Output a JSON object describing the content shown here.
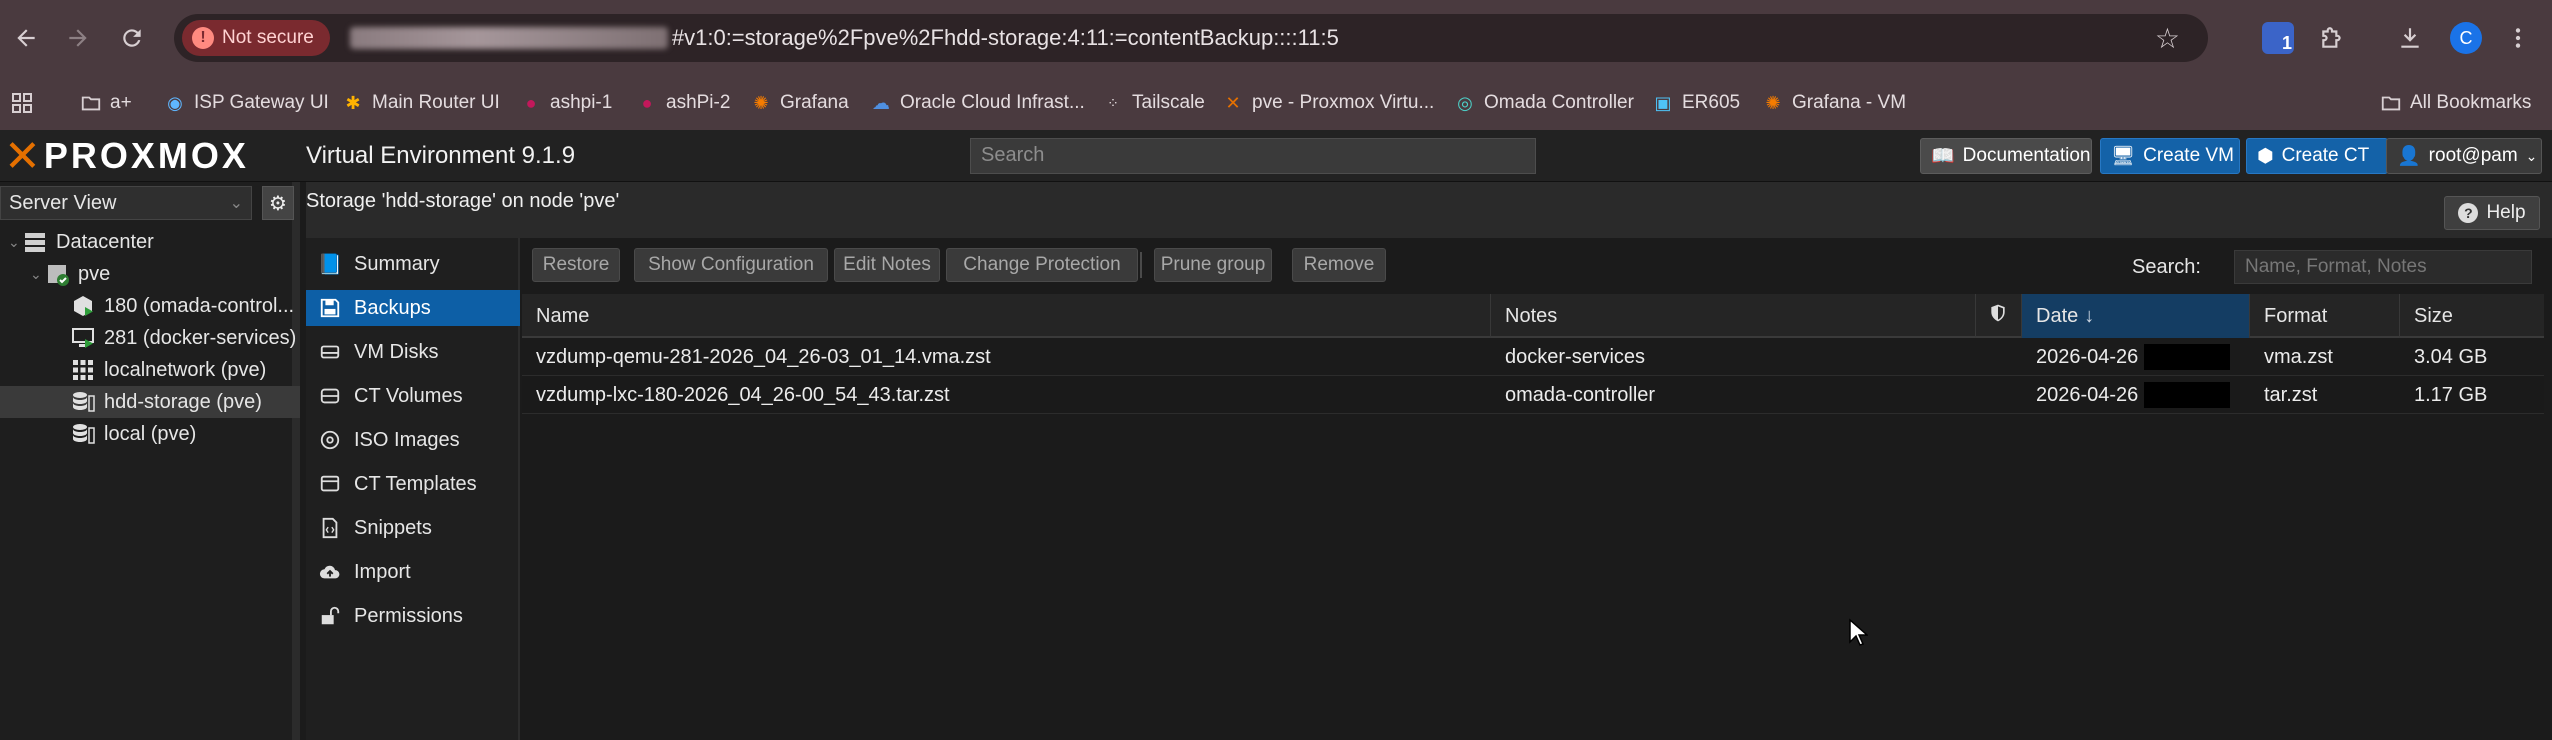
{
  "browser": {
    "not_secure_label": "Not secure",
    "url_visible": "#v1:0:=storage%2Fpve%2Fhdd-storage:4:11:=contentBackup::::11:5",
    "extension_badge": "1",
    "profile_initial": "C",
    "bookmarks": [
      {
        "label": "a+",
        "icon": "folder-icon"
      },
      {
        "label": "ISP Gateway UI",
        "icon": "globe-icon"
      },
      {
        "label": "Main Router UI",
        "icon": "router-icon"
      },
      {
        "label": "ashpi-1",
        "icon": "raspberry-icon"
      },
      {
        "label": "ashPi-2",
        "icon": "raspberry-icon"
      },
      {
        "label": "Grafana",
        "icon": "grafana-icon"
      },
      {
        "label": "Oracle Cloud Infrast...",
        "icon": "cloud-icon"
      },
      {
        "label": "Tailscale",
        "icon": "tailscale-icon"
      },
      {
        "label": "pve - Proxmox Virtu...",
        "icon": "proxmox-icon"
      },
      {
        "label": "Omada Controller",
        "icon": "omada-icon"
      },
      {
        "label": "ER605",
        "icon": "tplink-icon"
      },
      {
        "label": "Grafana - VM",
        "icon": "grafana-icon"
      }
    ],
    "all_bookmarks_label": "All Bookmarks"
  },
  "header": {
    "logo_text": "PROXMOX",
    "version": "Virtual Environment 9.1.9",
    "search_placeholder": "Search",
    "documentation_label": "Documentation",
    "create_vm_label": "Create VM",
    "create_ct_label": "Create CT",
    "user_label": "root@pam"
  },
  "tree": {
    "view_label": "Server View",
    "items": [
      {
        "label": "Datacenter",
        "icon": "datacenter-icon"
      },
      {
        "label": "pve",
        "icon": "node-icon"
      },
      {
        "label": "180 (omada-control...",
        "icon": "container-icon"
      },
      {
        "label": "281 (docker-services)",
        "icon": "vm-icon"
      },
      {
        "label": "localnetwork (pve)",
        "icon": "network-icon"
      },
      {
        "label": "hdd-storage (pve)",
        "icon": "storage-icon"
      },
      {
        "label": "local (pve)",
        "icon": "storage-icon"
      }
    ]
  },
  "content": {
    "title": "Storage 'hdd-storage' on node 'pve'",
    "help_label": "Help",
    "nav": [
      {
        "label": "Summary",
        "icon": "book-icon"
      },
      {
        "label": "Backups",
        "icon": "floppy-icon"
      },
      {
        "label": "VM Disks",
        "icon": "disk-icon"
      },
      {
        "label": "CT Volumes",
        "icon": "volume-icon"
      },
      {
        "label": "ISO Images",
        "icon": "disc-icon"
      },
      {
        "label": "CT Templates",
        "icon": "template-icon"
      },
      {
        "label": "Snippets",
        "icon": "file-code-icon"
      },
      {
        "label": "Import",
        "icon": "cloud-upload-icon"
      },
      {
        "label": "Permissions",
        "icon": "unlock-icon"
      }
    ],
    "toolbar": {
      "restore": "Restore",
      "show_configuration": "Show Configuration",
      "edit_notes": "Edit Notes",
      "change_protection": "Change Protection",
      "prune_group": "Prune group",
      "remove": "Remove",
      "search_label": "Search:",
      "search_placeholder": "Name, Format, Notes"
    },
    "columns": {
      "name": "Name",
      "notes": "Notes",
      "date": "Date",
      "format": "Format",
      "size": "Size"
    },
    "rows": [
      {
        "name": "vzdump-qemu-281-2026_04_26-03_01_14.vma.zst",
        "notes": "docker-services",
        "date": "2026-04-26",
        "format": "vma.zst",
        "size": "3.04 GB"
      },
      {
        "name": "vzdump-lxc-180-2026_04_26-00_54_43.tar.zst",
        "notes": "omada-controller",
        "date": "2026-04-26",
        "format": "tar.zst",
        "size": "1.17 GB"
      }
    ]
  },
  "colors": {
    "accent": "#0d5fa6",
    "proxmox_orange": "#e57000",
    "not_secure_bg": "#7a2a2f"
  }
}
